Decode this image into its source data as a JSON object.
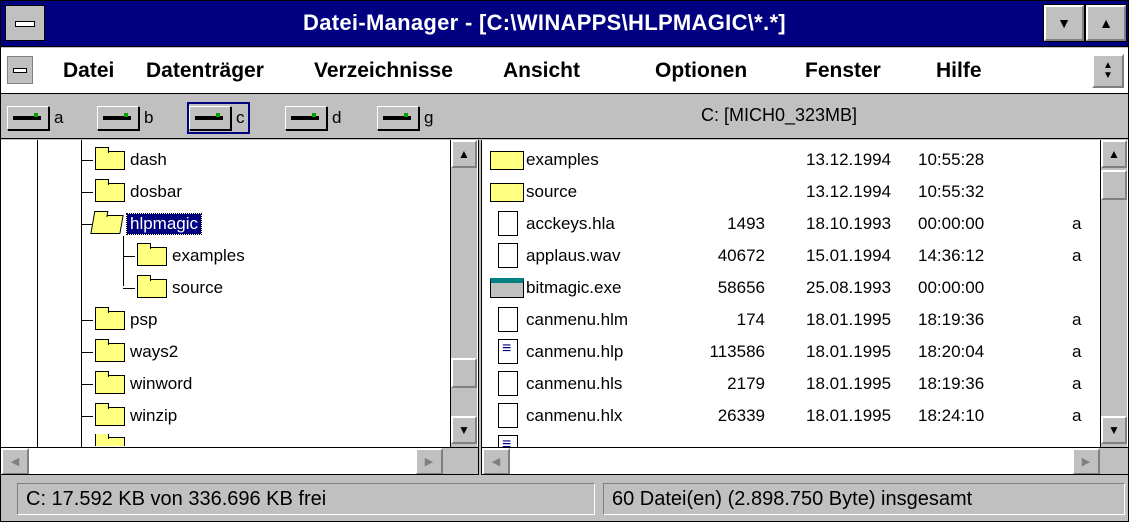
{
  "window": {
    "title": "Datei-Manager - [C:\\WINAPPS\\HLPMAGIC\\*.*]"
  },
  "menu": {
    "items": [
      {
        "label": "Datei"
      },
      {
        "label": "Datenträger"
      },
      {
        "label": "Verzeichnisse"
      },
      {
        "label": "Ansicht"
      },
      {
        "label": "Optionen"
      },
      {
        "label": "Fenster"
      },
      {
        "label": "Hilfe"
      }
    ]
  },
  "drives": {
    "items": [
      {
        "letter": "a"
      },
      {
        "letter": "b"
      },
      {
        "letter": "c",
        "selected": true
      },
      {
        "letter": "d"
      },
      {
        "letter": "g"
      }
    ],
    "current_label": "C: [MICH0_323MB]"
  },
  "tree": {
    "items": [
      {
        "name": "dash"
      },
      {
        "name": "dosbar"
      },
      {
        "name": "hlpmagic",
        "selected": true,
        "open": true
      },
      {
        "name": "examples"
      },
      {
        "name": "source"
      },
      {
        "name": "psp"
      },
      {
        "name": "ways2"
      },
      {
        "name": "winword"
      },
      {
        "name": "winzip"
      }
    ]
  },
  "files": {
    "rows": [
      {
        "name": "examples",
        "size": "",
        "date": "13.12.1994",
        "time": "10:55:28",
        "attr": "",
        "type": "dir"
      },
      {
        "name": "source",
        "size": "",
        "date": "13.12.1994",
        "time": "10:55:32",
        "attr": "",
        "type": "dir"
      },
      {
        "name": "acckeys.hla",
        "size": "1493",
        "date": "18.10.1993",
        "time": "00:00:00",
        "attr": "a",
        "type": "file"
      },
      {
        "name": "applaus.wav",
        "size": "40672",
        "date": "15.01.1994",
        "time": "14:36:12",
        "attr": "a",
        "type": "file"
      },
      {
        "name": "bitmagic.exe",
        "size": "58656",
        "date": "25.08.1993",
        "time": "00:00:00",
        "attr": "",
        "type": "exe"
      },
      {
        "name": "canmenu.hlm",
        "size": "174",
        "date": "18.01.1995",
        "time": "18:19:36",
        "attr": "a",
        "type": "file"
      },
      {
        "name": "canmenu.hlp",
        "size": "113586",
        "date": "18.01.1995",
        "time": "18:20:04",
        "attr": "a",
        "type": "hlp"
      },
      {
        "name": "canmenu.hls",
        "size": "2179",
        "date": "18.01.1995",
        "time": "18:19:36",
        "attr": "a",
        "type": "file"
      },
      {
        "name": "canmenu.hlx",
        "size": "26339",
        "date": "18.01.1995",
        "time": "18:24:10",
        "attr": "a",
        "type": "file"
      }
    ]
  },
  "status": {
    "free": "C: 17.592 KB von 336.696 KB frei",
    "total": "60 Datei(en) (2.898.750 Byte) insgesamt"
  },
  "colors": {
    "titlebar": "#000080",
    "folder": "#ffff80",
    "face": "#c0c0c0"
  }
}
